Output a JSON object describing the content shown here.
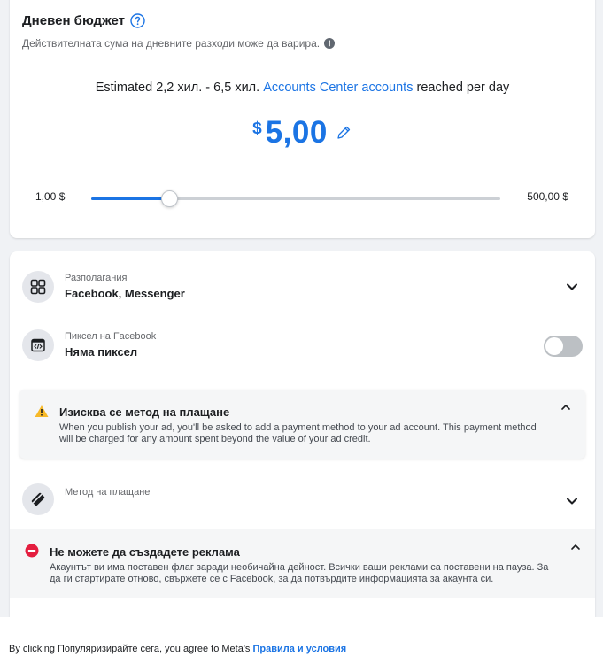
{
  "budget": {
    "title": "Дневен бюджет",
    "subtitle": "Действителната сума на дневните разходи може да варира.",
    "estimate_prefix": "Estimated 2,2 хил. - 6,5 хил.",
    "estimate_link": "Accounts Center accounts",
    "estimate_suffix": "reached per day",
    "currency_symbol": "$",
    "amount": "5,00",
    "slider_min_label": "1,00 $",
    "slider_max_label": "500,00 $",
    "slider_position_fraction": 0.19
  },
  "placements": {
    "label": "Разполагания",
    "value": "Facebook, Messenger"
  },
  "pixel": {
    "label": "Пиксел на Facebook",
    "value": "Няма пиксел",
    "enabled": false
  },
  "payment_warning": {
    "title": "Изисква се метод на плащане",
    "body": "When you publish your ad, you'll be asked to add a payment method to your ad account. This payment method will be charged for any amount spent beyond the value of your ad credit."
  },
  "payment_method": {
    "label": "Метод на плащане"
  },
  "error_notice": {
    "title": "Не можете да създадете реклама",
    "body": "Акаунтът ви има поставен флаг заради необичайна дейност. Всички ваши реклами са поставени на пауза. За да ги стартирате отново, свържете се с Facebook, за да потвърдите информацията за акаунта си."
  },
  "footer": {
    "prefix": "By clicking Популяризирайте сега, you agree to Meta's",
    "link": "Правила и условия"
  },
  "colors": {
    "accent": "#1b74e4",
    "warning": "#f7b928",
    "error": "#e41e3f"
  }
}
